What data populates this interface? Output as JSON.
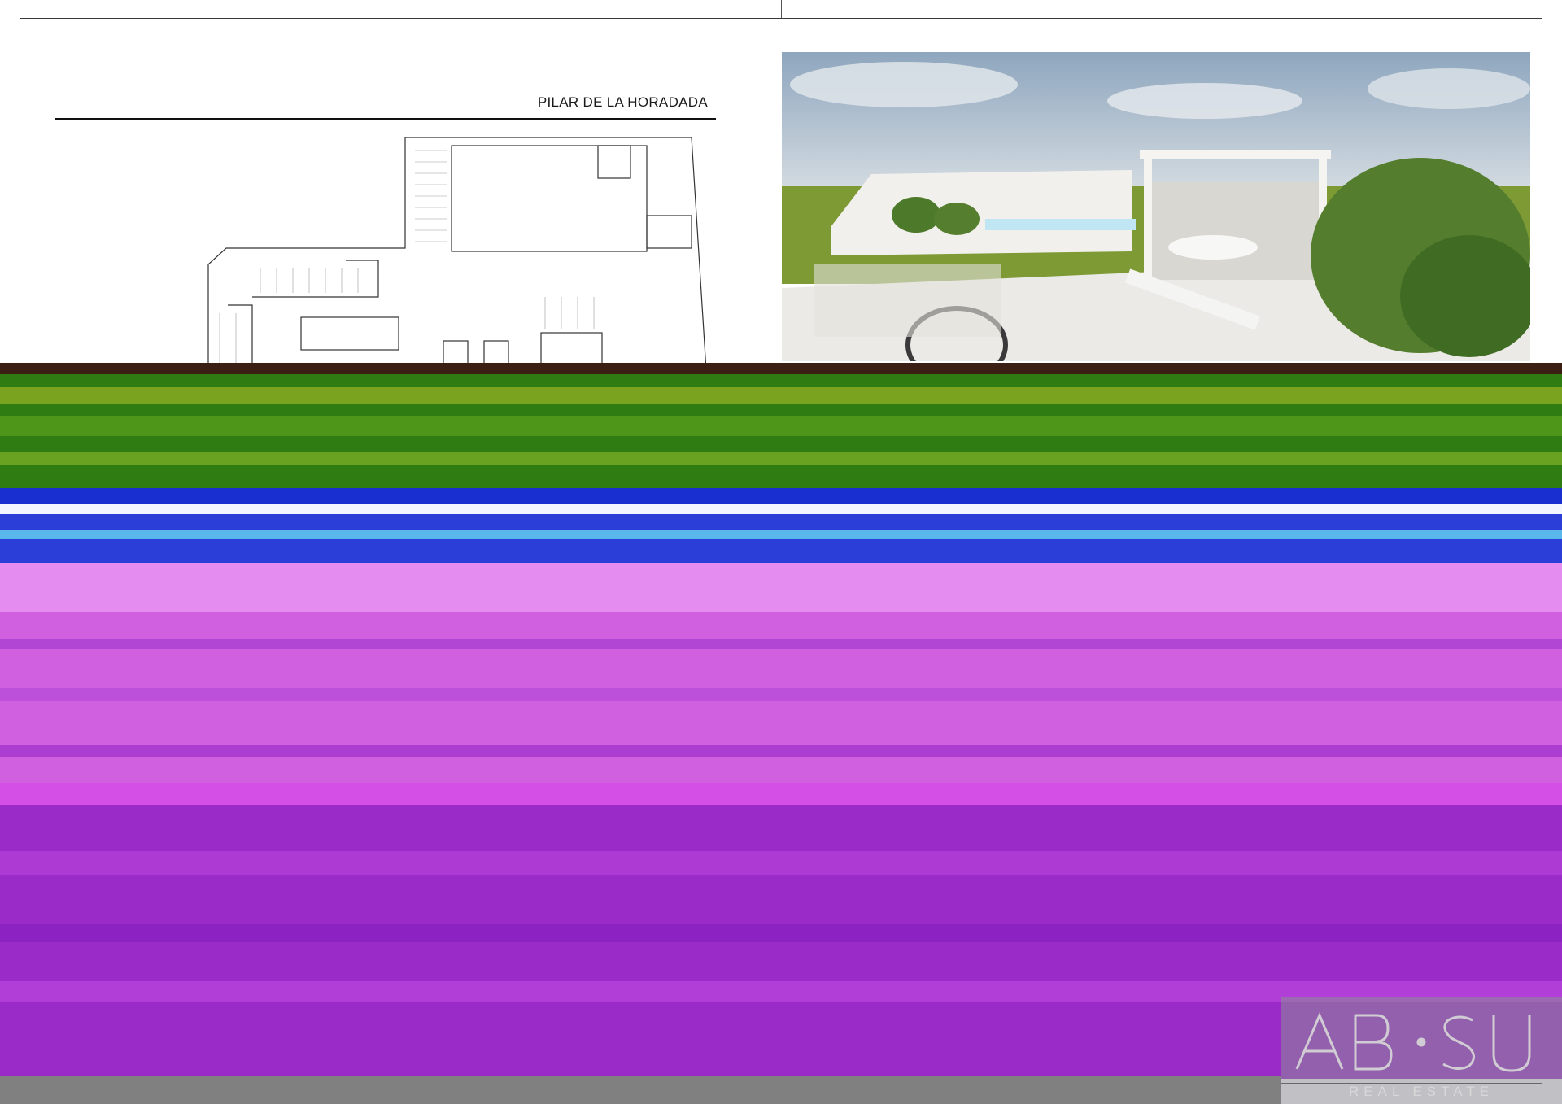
{
  "document": {
    "title": "PILAR DE LA HORADADA"
  },
  "logo": {
    "text": "AB·SU",
    "subtitle": "REAL ESTATE"
  },
  "colors": {
    "sky": "#a9bdd0",
    "grass": "#7d9a35",
    "wall": "#f0eeea",
    "pool": "#bfe6f2",
    "glitch_green": "#2f7d12",
    "glitch_blue": "#1a2fd0",
    "glitch_magenta": "#c44ad8",
    "glitch_purple": "#9a2bc8",
    "bar_grey": "#808080"
  }
}
